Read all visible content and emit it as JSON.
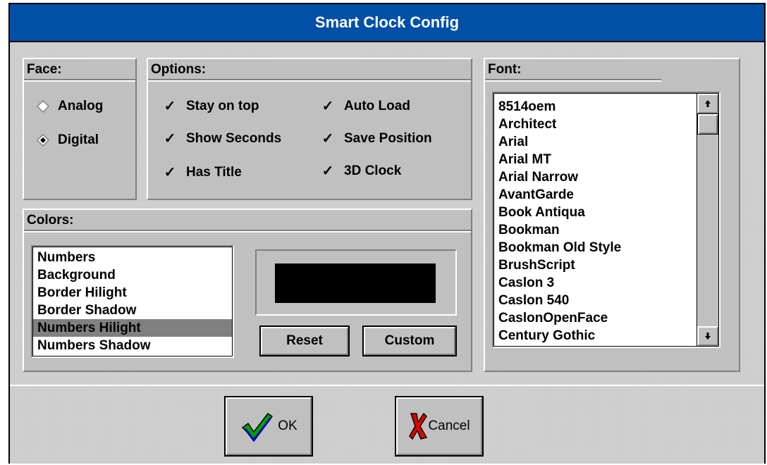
{
  "window": {
    "title": "Smart Clock Config"
  },
  "face": {
    "heading": "Face:",
    "options": [
      {
        "label": "Analog",
        "selected": false
      },
      {
        "label": "Digital",
        "selected": true
      }
    ]
  },
  "options": {
    "heading": "Options:",
    "checks": [
      {
        "label": "Stay on top",
        "checked": true
      },
      {
        "label": "Show Seconds",
        "checked": true
      },
      {
        "label": "Has Title",
        "checked": true
      },
      {
        "label": "Auto Load",
        "checked": true
      },
      {
        "label": "Save Position",
        "checked": true
      },
      {
        "label": "3D Clock",
        "checked": true
      }
    ],
    "check_glyph": "✓"
  },
  "font": {
    "heading": "Font:",
    "items": [
      "8514oem",
      "Architect",
      "Arial",
      "Arial MT",
      "Arial Narrow",
      "AvantGarde",
      "Book Antiqua",
      "Bookman",
      "Bookman Old Style",
      "BrushScript",
      "Caslon 3",
      "Caslon 540",
      "CaslonOpenFace",
      "Century Gothic"
    ]
  },
  "colors": {
    "heading": "Colors:",
    "items": [
      "Numbers",
      "Background",
      "Border Hilight",
      "Border Shadow",
      "Numbers Hilight",
      "Numbers Shadow"
    ],
    "selected_index": 4,
    "swatch_color": "#000000",
    "reset_label": "Reset",
    "custom_label": "Custom"
  },
  "buttons": {
    "ok_label": "OK",
    "cancel_label": "Cancel"
  },
  "theme": {
    "title_bar": "#0050a8",
    "face": "#c0c0c0"
  }
}
